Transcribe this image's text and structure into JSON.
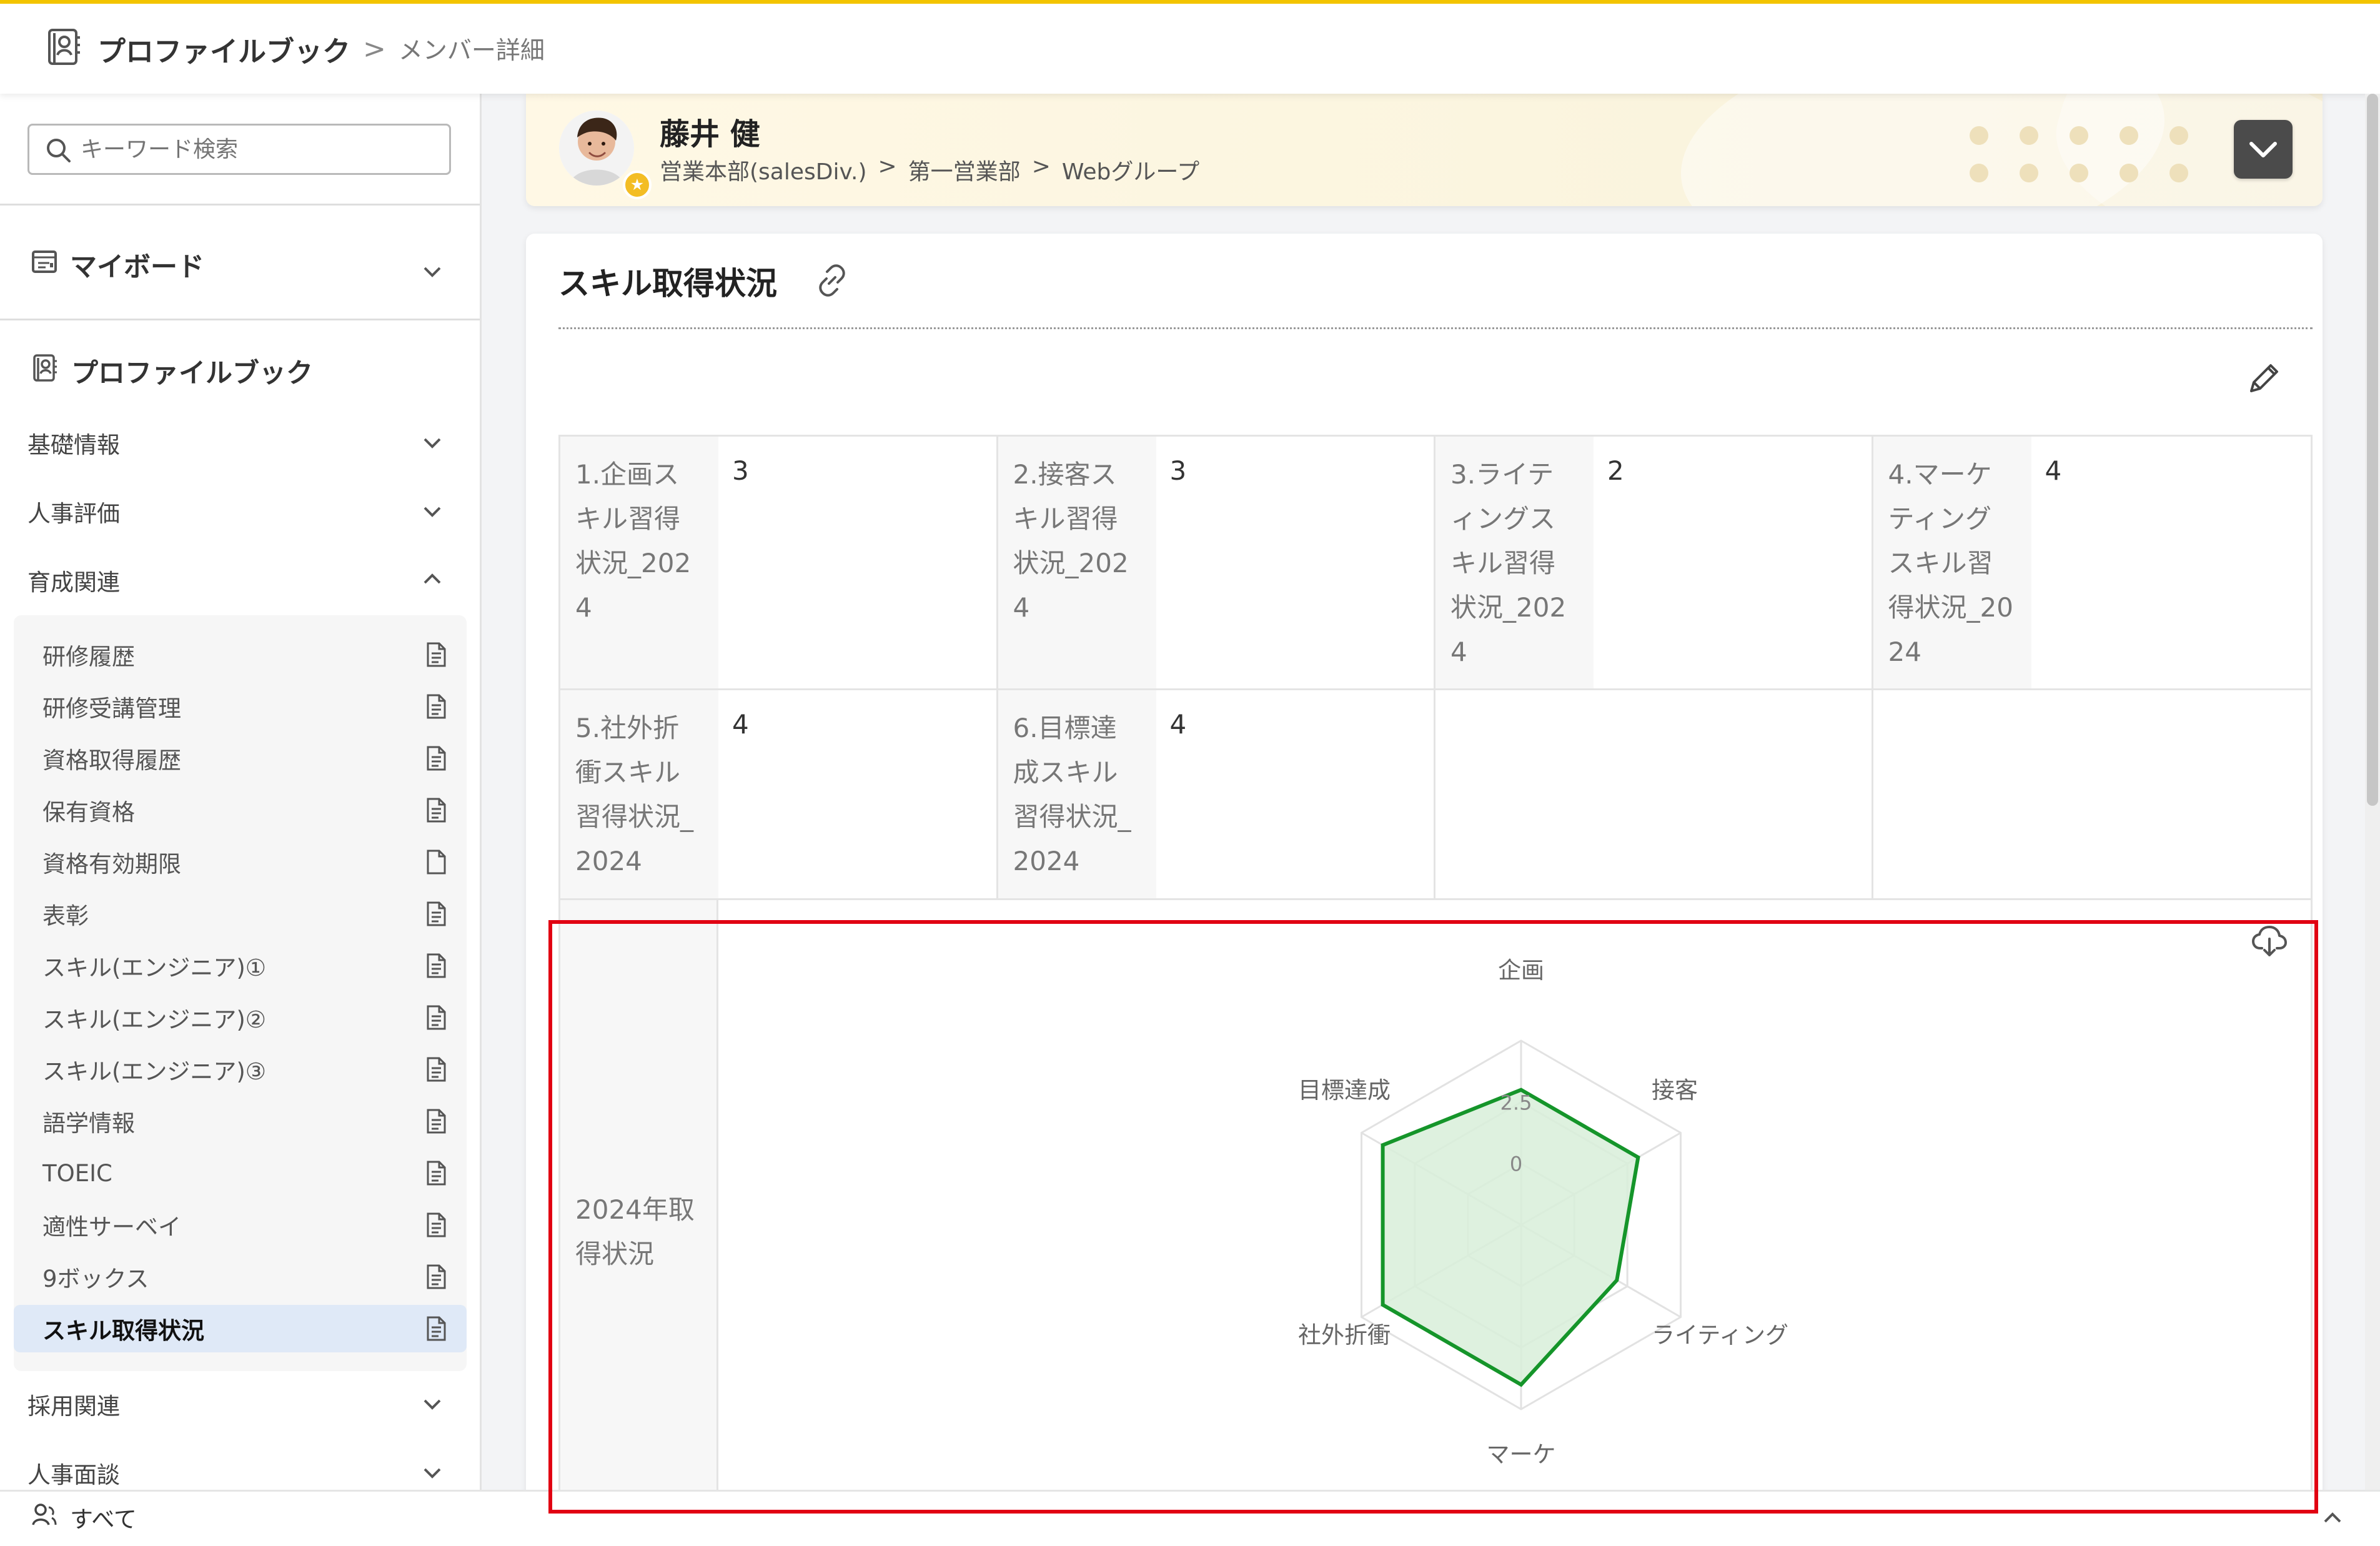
{
  "header": {
    "title": "プロファイルブック",
    "separator": ">",
    "current_page": "メンバー詳細",
    "icon": "profilebook-icon"
  },
  "sidebar": {
    "search_placeholder": "キーワード検索",
    "myboard_label": "マイボード",
    "profilebook_label": "プロファイルブック",
    "sections": [
      {
        "label": "基礎情報",
        "state": "collapsed"
      },
      {
        "label": "人事評価",
        "state": "collapsed"
      },
      {
        "label": "育成関連",
        "state": "expanded"
      },
      {
        "label": "採用関連",
        "state": "collapsed"
      },
      {
        "label": "人事面談",
        "state": "collapsed"
      }
    ],
    "development_items": [
      {
        "label": "研修履歴",
        "icon": "document-lines-icon",
        "active": false
      },
      {
        "label": "研修受講管理",
        "icon": "document-lines-icon",
        "active": false
      },
      {
        "label": "資格取得履歴",
        "icon": "document-lines-icon",
        "active": false
      },
      {
        "label": "保有資格",
        "icon": "document-lines-icon",
        "active": false
      },
      {
        "label": "資格有効期限",
        "icon": "blank-document-icon",
        "active": false
      },
      {
        "label": "表彰",
        "icon": "document-lines-icon",
        "active": false
      },
      {
        "label": "スキル(エンジニア)①",
        "icon": "document-lines-icon",
        "active": false
      },
      {
        "label": "スキル(エンジニア)②",
        "icon": "document-lines-icon",
        "active": false
      },
      {
        "label": "スキル(エンジニア)③",
        "icon": "document-lines-icon",
        "active": false
      },
      {
        "label": "語学情報",
        "icon": "document-lines-icon",
        "active": false
      },
      {
        "label": "TOEIC",
        "icon": "document-lines-icon",
        "active": false
      },
      {
        "label": "適性サーベイ",
        "icon": "document-lines-icon",
        "active": false
      },
      {
        "label": "9ボックス",
        "icon": "document-lines-icon",
        "active": false
      },
      {
        "label": "スキル取得状況",
        "icon": "document-lines-icon",
        "active": true
      }
    ],
    "footer_label": "すべて"
  },
  "member": {
    "name": "藤井 健",
    "path": [
      "営業本部(salesDiv.)",
      ">",
      "第一営業部",
      ">",
      "Webグループ"
    ],
    "avatar_icon": "person-avatar-icon",
    "badge_icon": "star-badge-icon"
  },
  "main": {
    "section_title": "スキル取得状況",
    "skills": [
      {
        "label": "1.企画ス\nキル習得\n状況_202\n4",
        "value": "3"
      },
      {
        "label": "2.接客ス\nキル習得\n状況_202\n4",
        "value": "3"
      },
      {
        "label": "3.ライテ\nィングス\nキル習得\n状況_202\n4",
        "value": "2"
      },
      {
        "label": "4.マーケ\nティング\nスキル習\n得状況_20\n24",
        "value": "4"
      },
      {
        "label": "5.社外折\n衝スキル\n習得状況_\n2024",
        "value": "4"
      },
      {
        "label": "6.目標達\n成スキル\n習得状況_\n2024",
        "value": "4"
      }
    ],
    "chart_label": "2024年取\n得状況"
  },
  "colors": {
    "accent_yellow": "#f3c400",
    "highlight_red": "#e10012",
    "radar_green": "#15952a",
    "radar_fill": "#d8efd9",
    "active_item": "#dfe9f7"
  },
  "chart_data": {
    "type": "radar",
    "categories": [
      "企画",
      "接客",
      "ライティング",
      "マーケ",
      "社外折衝",
      "目標達成"
    ],
    "values": [
      3,
      3,
      2,
      4,
      4,
      4
    ],
    "range": [
      -2.5,
      5
    ],
    "tick_labels": [
      "0",
      "2.5"
    ],
    "grid": true,
    "legend": "none"
  }
}
